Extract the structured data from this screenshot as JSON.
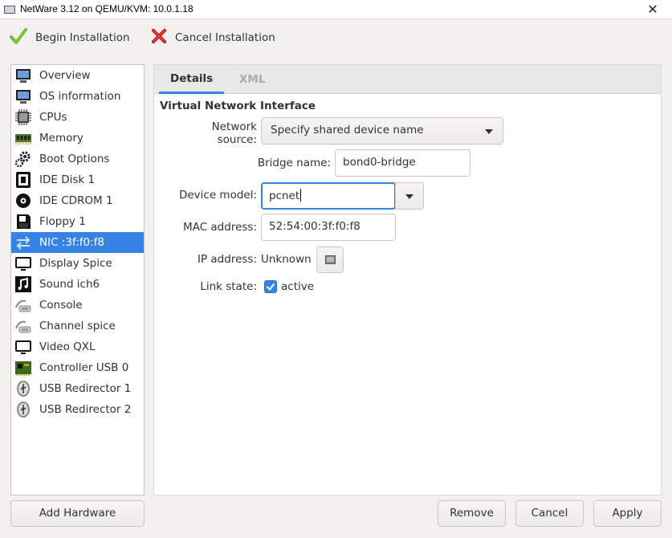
{
  "window": {
    "title": "NetWare 3.12 on QEMU/KVM: 10.0.1.18",
    "close_glyph": "✕"
  },
  "toolbar": {
    "begin_label": "Begin Installation",
    "cancel_label": "Cancel Installation"
  },
  "sidebar": {
    "items": [
      {
        "label": "Overview",
        "icon": "monitor-icon"
      },
      {
        "label": "OS information",
        "icon": "monitor-icon"
      },
      {
        "label": "CPUs",
        "icon": "cpu-icon"
      },
      {
        "label": "Memory",
        "icon": "memory-icon"
      },
      {
        "label": "Boot Options",
        "icon": "gears-icon"
      },
      {
        "label": "IDE Disk 1",
        "icon": "disk-icon"
      },
      {
        "label": "IDE CDROM 1",
        "icon": "cdrom-icon"
      },
      {
        "label": "Floppy 1",
        "icon": "floppy-icon"
      },
      {
        "label": "NIC :3f:f0:f8",
        "icon": "nic-icon",
        "selected": true
      },
      {
        "label": "Display Spice",
        "icon": "display-icon"
      },
      {
        "label": "Sound ich6",
        "icon": "sound-icon"
      },
      {
        "label": "Console",
        "icon": "serial-icon"
      },
      {
        "label": "Channel spice",
        "icon": "serial-icon"
      },
      {
        "label": "Video QXL",
        "icon": "display-icon"
      },
      {
        "label": "Controller USB 0",
        "icon": "controller-icon"
      },
      {
        "label": "USB Redirector 1",
        "icon": "usb-icon"
      },
      {
        "label": "USB Redirector 2",
        "icon": "usb-icon"
      }
    ]
  },
  "tabs": {
    "details": "Details",
    "xml": "XML"
  },
  "form": {
    "section_title": "Virtual Network Interface",
    "network_source_label": "Network source:",
    "network_source_value": "Specify shared device name",
    "bridge_name_label": "Bridge name:",
    "bridge_name_value": "bond0-bridge",
    "device_model_label": "Device model:",
    "device_model_value": "pcnet",
    "mac_label": "MAC address:",
    "mac_value": "52:54:00:3f:f0:f8",
    "ip_label": "IP address:",
    "ip_value": "Unknown",
    "link_label": "Link state:",
    "link_value": "active",
    "link_checked": true
  },
  "buttons": {
    "add_hardware": "Add Hardware",
    "remove": "Remove",
    "cancel": "Cancel",
    "apply": "Apply"
  },
  "colors": {
    "accent": "#3584e4"
  }
}
